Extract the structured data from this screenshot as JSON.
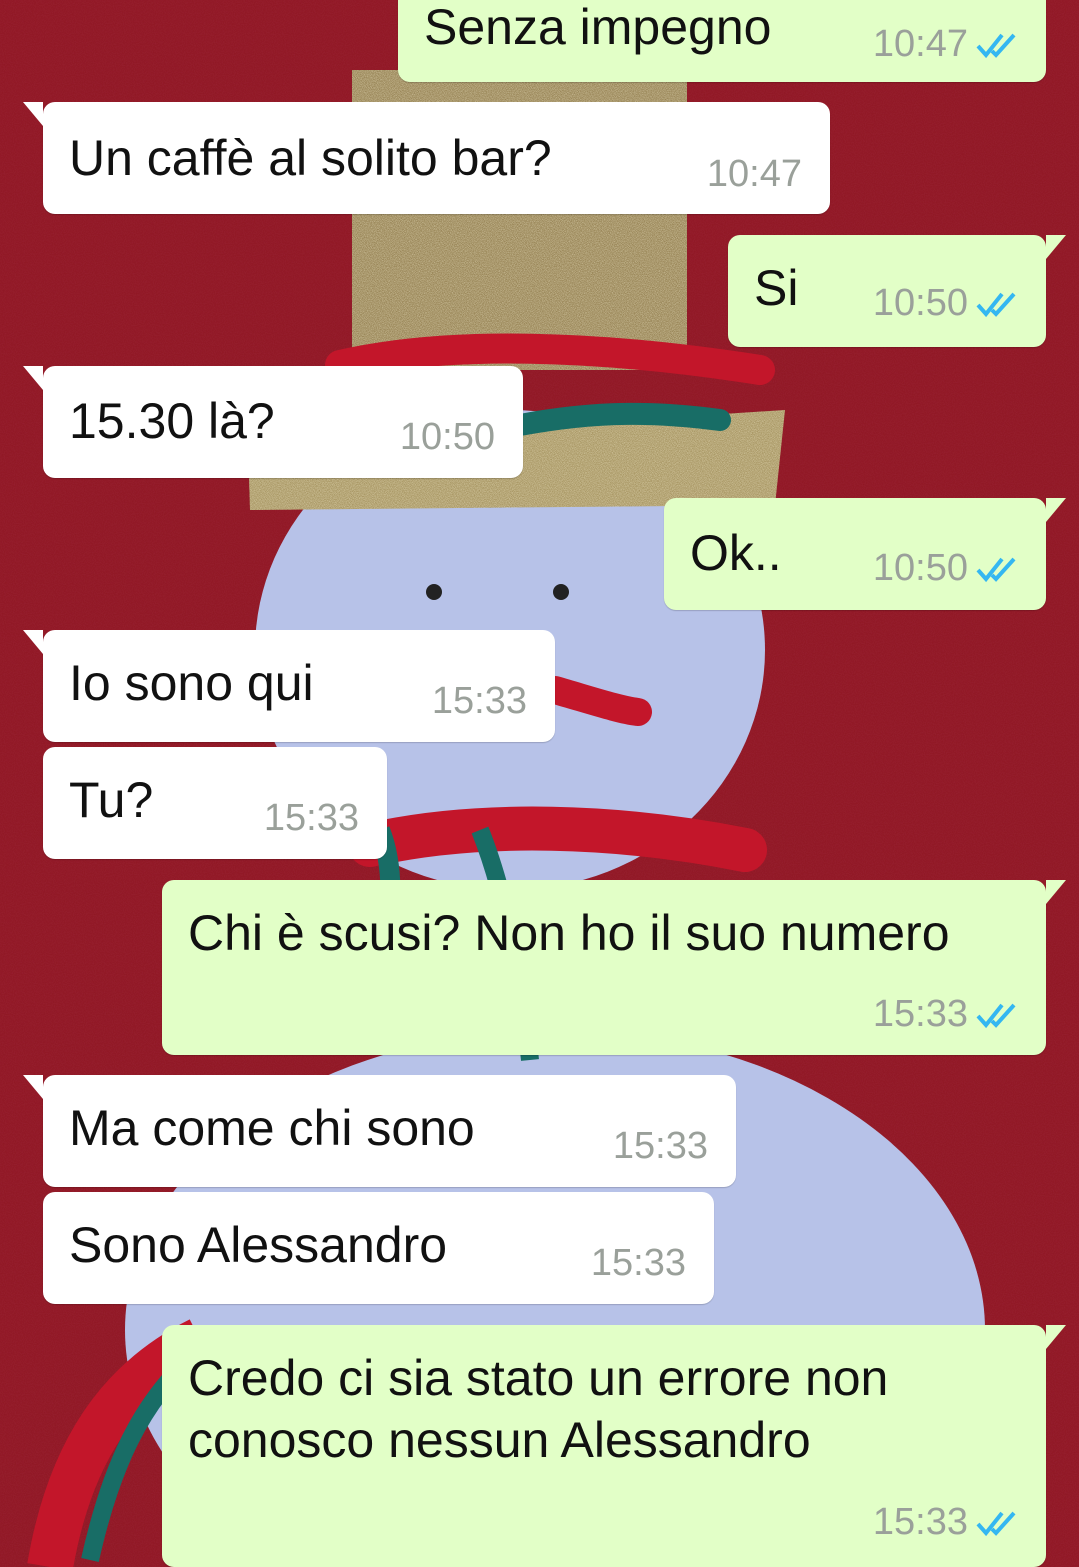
{
  "colors": {
    "wallpaper_felt": "#8e1620",
    "incoming_bubble": "#ffffff",
    "outgoing_bubble": "#e2ffc7",
    "timestamp_text": "#9aa09a",
    "read_ticks": "#34b7f1"
  },
  "icons": {
    "read_receipt": "double-check-icon"
  },
  "messages": [
    {
      "direction": "out",
      "text": "Senza impegno",
      "time": "10:47",
      "read": true
    },
    {
      "direction": "in",
      "text": "Un caffè al solito bar?",
      "time": "10:47"
    },
    {
      "direction": "out",
      "text": "Si",
      "time": "10:50",
      "read": true
    },
    {
      "direction": "in",
      "text": "15.30 là?",
      "time": "10:50"
    },
    {
      "direction": "out",
      "text": "Ok..",
      "time": "10:50",
      "read": true
    },
    {
      "direction": "in",
      "text": "Io sono qui",
      "time": "15:33"
    },
    {
      "direction": "in",
      "text": "Tu?",
      "time": "15:33"
    },
    {
      "direction": "out",
      "text": "Chi è scusi? Non ho il suo numero",
      "time": "15:33",
      "read": true
    },
    {
      "direction": "in",
      "text": "Ma come chi sono",
      "time": "15:33"
    },
    {
      "direction": "in",
      "text": "Sono Alessandro",
      "time": "15:33"
    },
    {
      "direction": "out",
      "text": "Credo ci sia stato un errore non\nconosco nessun Alessandro",
      "time": "15:33",
      "read": true
    }
  ]
}
